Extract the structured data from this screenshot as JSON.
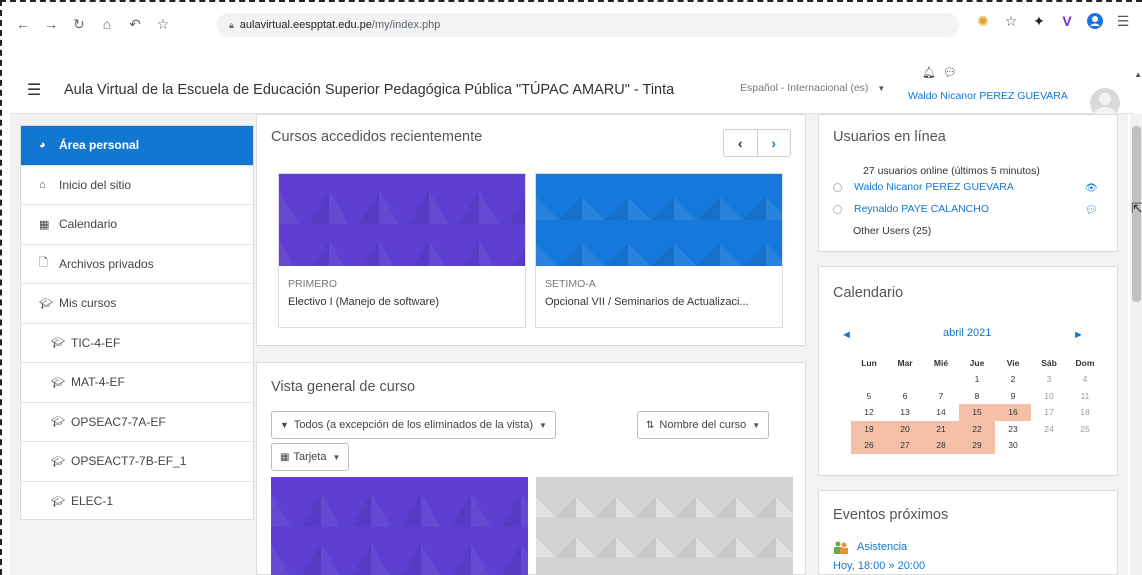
{
  "browser": {
    "url_domain": "aulavirtual.eespptat.edu.pe",
    "url_path": "/my/index.php"
  },
  "navbar": {
    "site_title": "Aula Virtual de la Escuela de Educación Superior Pedagógica Pública \"TÚPAC AMARU\" - Tinta",
    "language": "Español - Internacional (es)",
    "user_name": "Waldo Nicanor PEREZ GUEVARA"
  },
  "sidebar": {
    "items": [
      {
        "label": "Área personal"
      },
      {
        "label": "Inicio del sitio"
      },
      {
        "label": "Calendario"
      },
      {
        "label": "Archivos privados"
      },
      {
        "label": "Mis cursos"
      },
      {
        "label": "TIC-4-EF"
      },
      {
        "label": "MAT-4-EF"
      },
      {
        "label": "OPSEAC7-7A-EF"
      },
      {
        "label": "OPSEACT7-7B-EF_1"
      },
      {
        "label": "ELEC-1"
      }
    ]
  },
  "recent": {
    "title": "Cursos accedidos recientemente",
    "prev": "‹",
    "next": "›",
    "courses": [
      {
        "category": "PRIMERO",
        "name": "Electivo I (Manejo de software)"
      },
      {
        "category": "SETIMO-A",
        "name": "Opcional VII / Seminarios de Actualizaci..."
      }
    ]
  },
  "overview": {
    "title": "Vista general de curso",
    "filter": "Todos (a excepción de los eliminados de la vista)",
    "sort": "Nombre del curso",
    "view": "Tarjeta"
  },
  "online_users": {
    "title": "Usuarios en línea",
    "summary": "27 usuarios online (últimos 5 minutos)",
    "users": [
      {
        "name": "Waldo Nicanor PEREZ GUEVARA"
      },
      {
        "name": "Reynaldo PAYE CALANCHO"
      }
    ],
    "others": "Other Users (25)"
  },
  "calendar": {
    "title": "Calendario",
    "month": "abril 2021",
    "weekdays": [
      "Lun",
      "Mar",
      "Mié",
      "Jue",
      "Vie",
      "Sáb",
      "Dom"
    ],
    "weeks": [
      [
        "",
        "",
        "",
        "1",
        "2",
        "3",
        "4"
      ],
      [
        "5",
        "6",
        "7",
        "8",
        "9",
        "10",
        "11"
      ],
      [
        "12",
        "13",
        "14",
        "15",
        "16",
        "17",
        "18"
      ],
      [
        "19",
        "20",
        "21",
        "22",
        "23",
        "24",
        "25"
      ],
      [
        "26",
        "27",
        "28",
        "29",
        "30",
        "",
        ""
      ]
    ],
    "highlighted": [
      "15",
      "16",
      "19",
      "20",
      "21",
      "22",
      "26",
      "27",
      "28",
      "29"
    ],
    "highlight_color": "#f4c1a8"
  },
  "events": {
    "title": "Eventos próximos",
    "items": [
      {
        "name": "Asistencia",
        "time": "Hoy, 18:00 » 20:00"
      }
    ]
  },
  "colors": {
    "accent": "#1177d1",
    "course_purple": "#5e3fd1",
    "course_blue": "#1578da"
  }
}
